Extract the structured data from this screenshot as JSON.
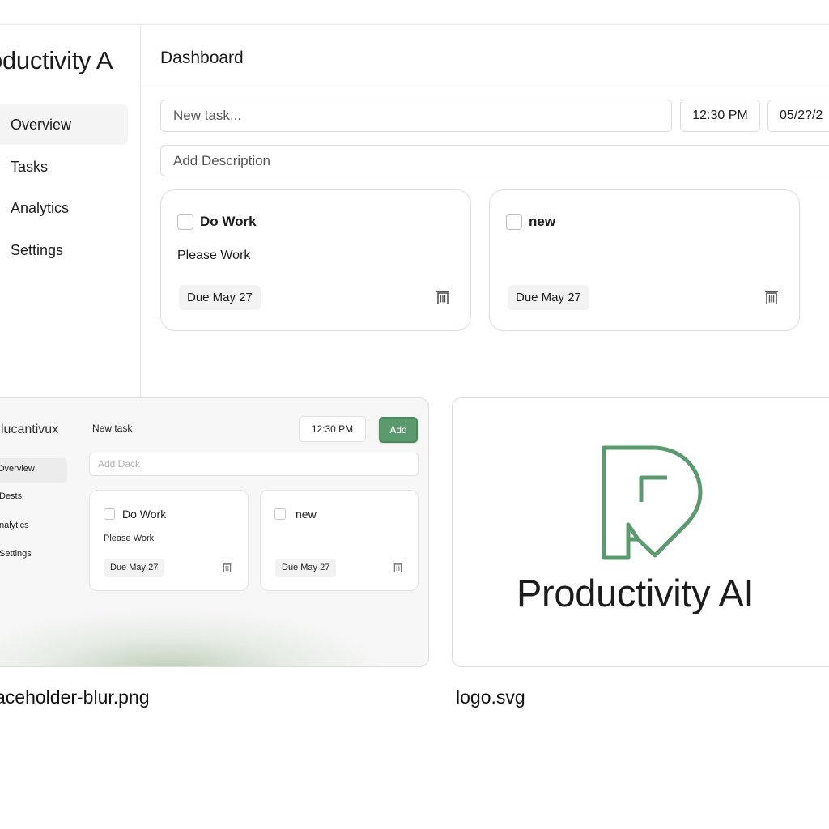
{
  "app": {
    "brand": "oductivity A",
    "page_title": "Dashboard",
    "nav": [
      "Overview",
      "Tasks",
      "Analytics",
      "Settings"
    ],
    "active_nav": "Overview",
    "new_task_placeholder": "New task...",
    "time_value": "12:30 PM",
    "date_value": "05/2?/2",
    "description_placeholder": "Add Description",
    "tasks": [
      {
        "title": "Do Work",
        "description": "Please Work",
        "due": "Due May 27",
        "checked": false
      },
      {
        "title": "new",
        "description": "",
        "due": "Due May 27",
        "checked": false
      }
    ]
  },
  "preview": {
    "brand": "lucantivux",
    "new_task_label": "New task",
    "time_value": "12:30 PM",
    "add_button": "Add",
    "description_placeholder": "Add Dack",
    "nav": [
      "Overview",
      "Dests",
      "nalytics",
      "Settings"
    ],
    "tasks": [
      {
        "title": "Do Work",
        "description": "Please Work",
        "due": "Due May 27"
      },
      {
        "title": "new",
        "description": "",
        "due": "Due May 27"
      }
    ]
  },
  "logo": {
    "text": "Productivity AI",
    "accent_color": "#5b9a6e"
  },
  "captions": {
    "placeholder_file": "aceholder-blur.png",
    "logo_file": "logo.svg"
  }
}
